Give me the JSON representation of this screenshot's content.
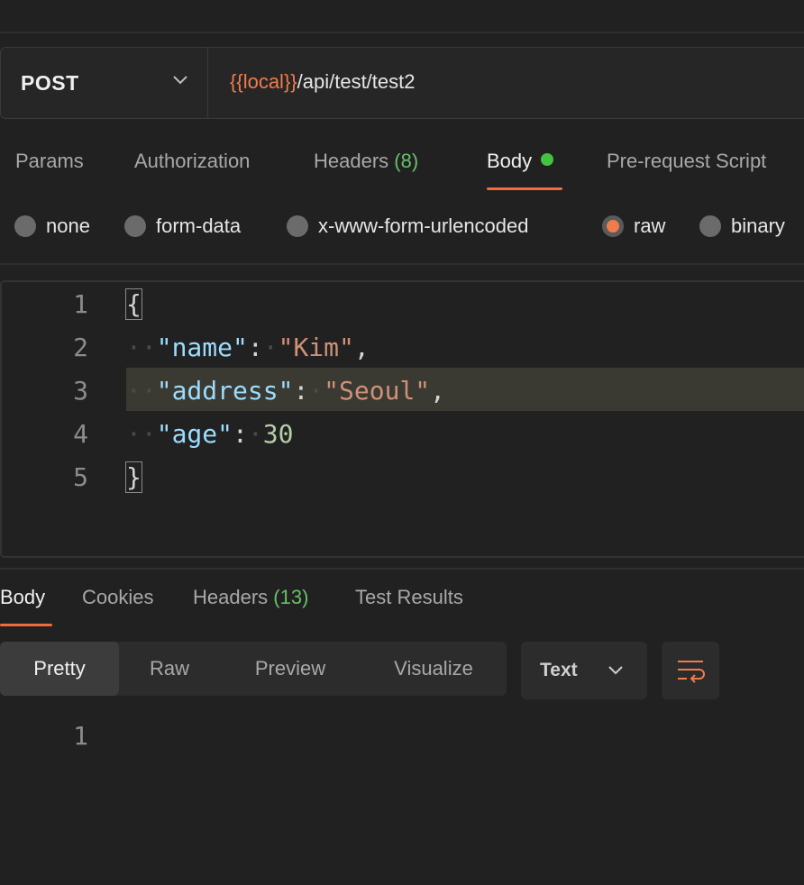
{
  "request": {
    "method": "POST",
    "url_variable": "{{local}}",
    "url_path": "/api/test/test2"
  },
  "request_tabs": {
    "params": "Params",
    "authorization": "Authorization",
    "headers": "Headers",
    "headers_count": "(8)",
    "body": "Body",
    "prerequest": "Pre-request Script"
  },
  "body_types": {
    "none": "none",
    "form_data": "form-data",
    "urlencoded": "x-www-form-urlencoded",
    "raw": "raw",
    "binary": "binary",
    "selected": "raw"
  },
  "editor": {
    "line_numbers": [
      "1",
      "2",
      "3",
      "4",
      "5"
    ],
    "lines": {
      "l1_brace": "{",
      "l2_key": "\"name\"",
      "l2_value": "\"Kim\"",
      "l3_key": "\"address\"",
      "l3_value": "\"Seoul\"",
      "l4_key": "\"age\"",
      "l4_value": "30",
      "l5_brace": "}"
    }
  },
  "response_tabs": {
    "body": "Body",
    "cookies": "Cookies",
    "headers": "Headers",
    "headers_count": "(13)",
    "test_results": "Test Results"
  },
  "response_view": {
    "pretty": "Pretty",
    "raw": "Raw",
    "preview": "Preview",
    "visualize": "Visualize",
    "format": "Text",
    "line_number": "1"
  },
  "colors": {
    "accent": "#f26b3a",
    "variable": "#f07c4c",
    "status_dot": "#44c244",
    "count": "#6abf69"
  }
}
